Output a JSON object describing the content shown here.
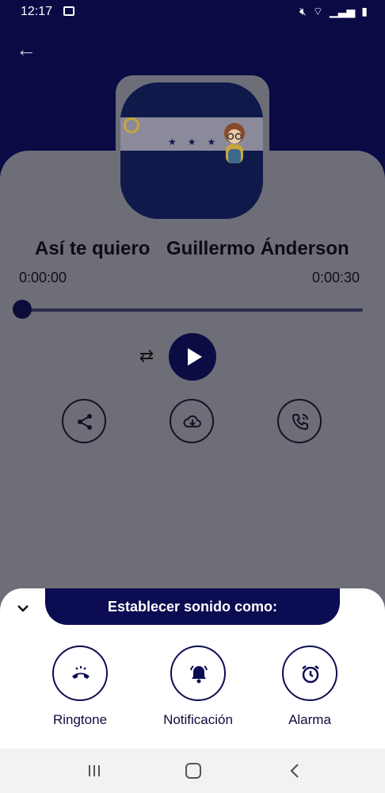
{
  "status_bar": {
    "time": "12:17"
  },
  "player": {
    "title": "Así te quiero",
    "artist": "Guillermo Ánderson",
    "time_start": "0:00:00",
    "time_end": "0:00:30",
    "progress": 0
  },
  "sheet": {
    "heading": "Establecer sonido como:",
    "options": [
      {
        "label": "Ringtone",
        "icon": "phone-hangup-icon"
      },
      {
        "label": "Notificación",
        "icon": "bell-icon"
      },
      {
        "label": "Alarma",
        "icon": "alarm-clock-icon"
      }
    ]
  },
  "colors": {
    "primary": "#0c0c52",
    "overlay": "#6e6e78",
    "sheet": "#ffffff"
  }
}
